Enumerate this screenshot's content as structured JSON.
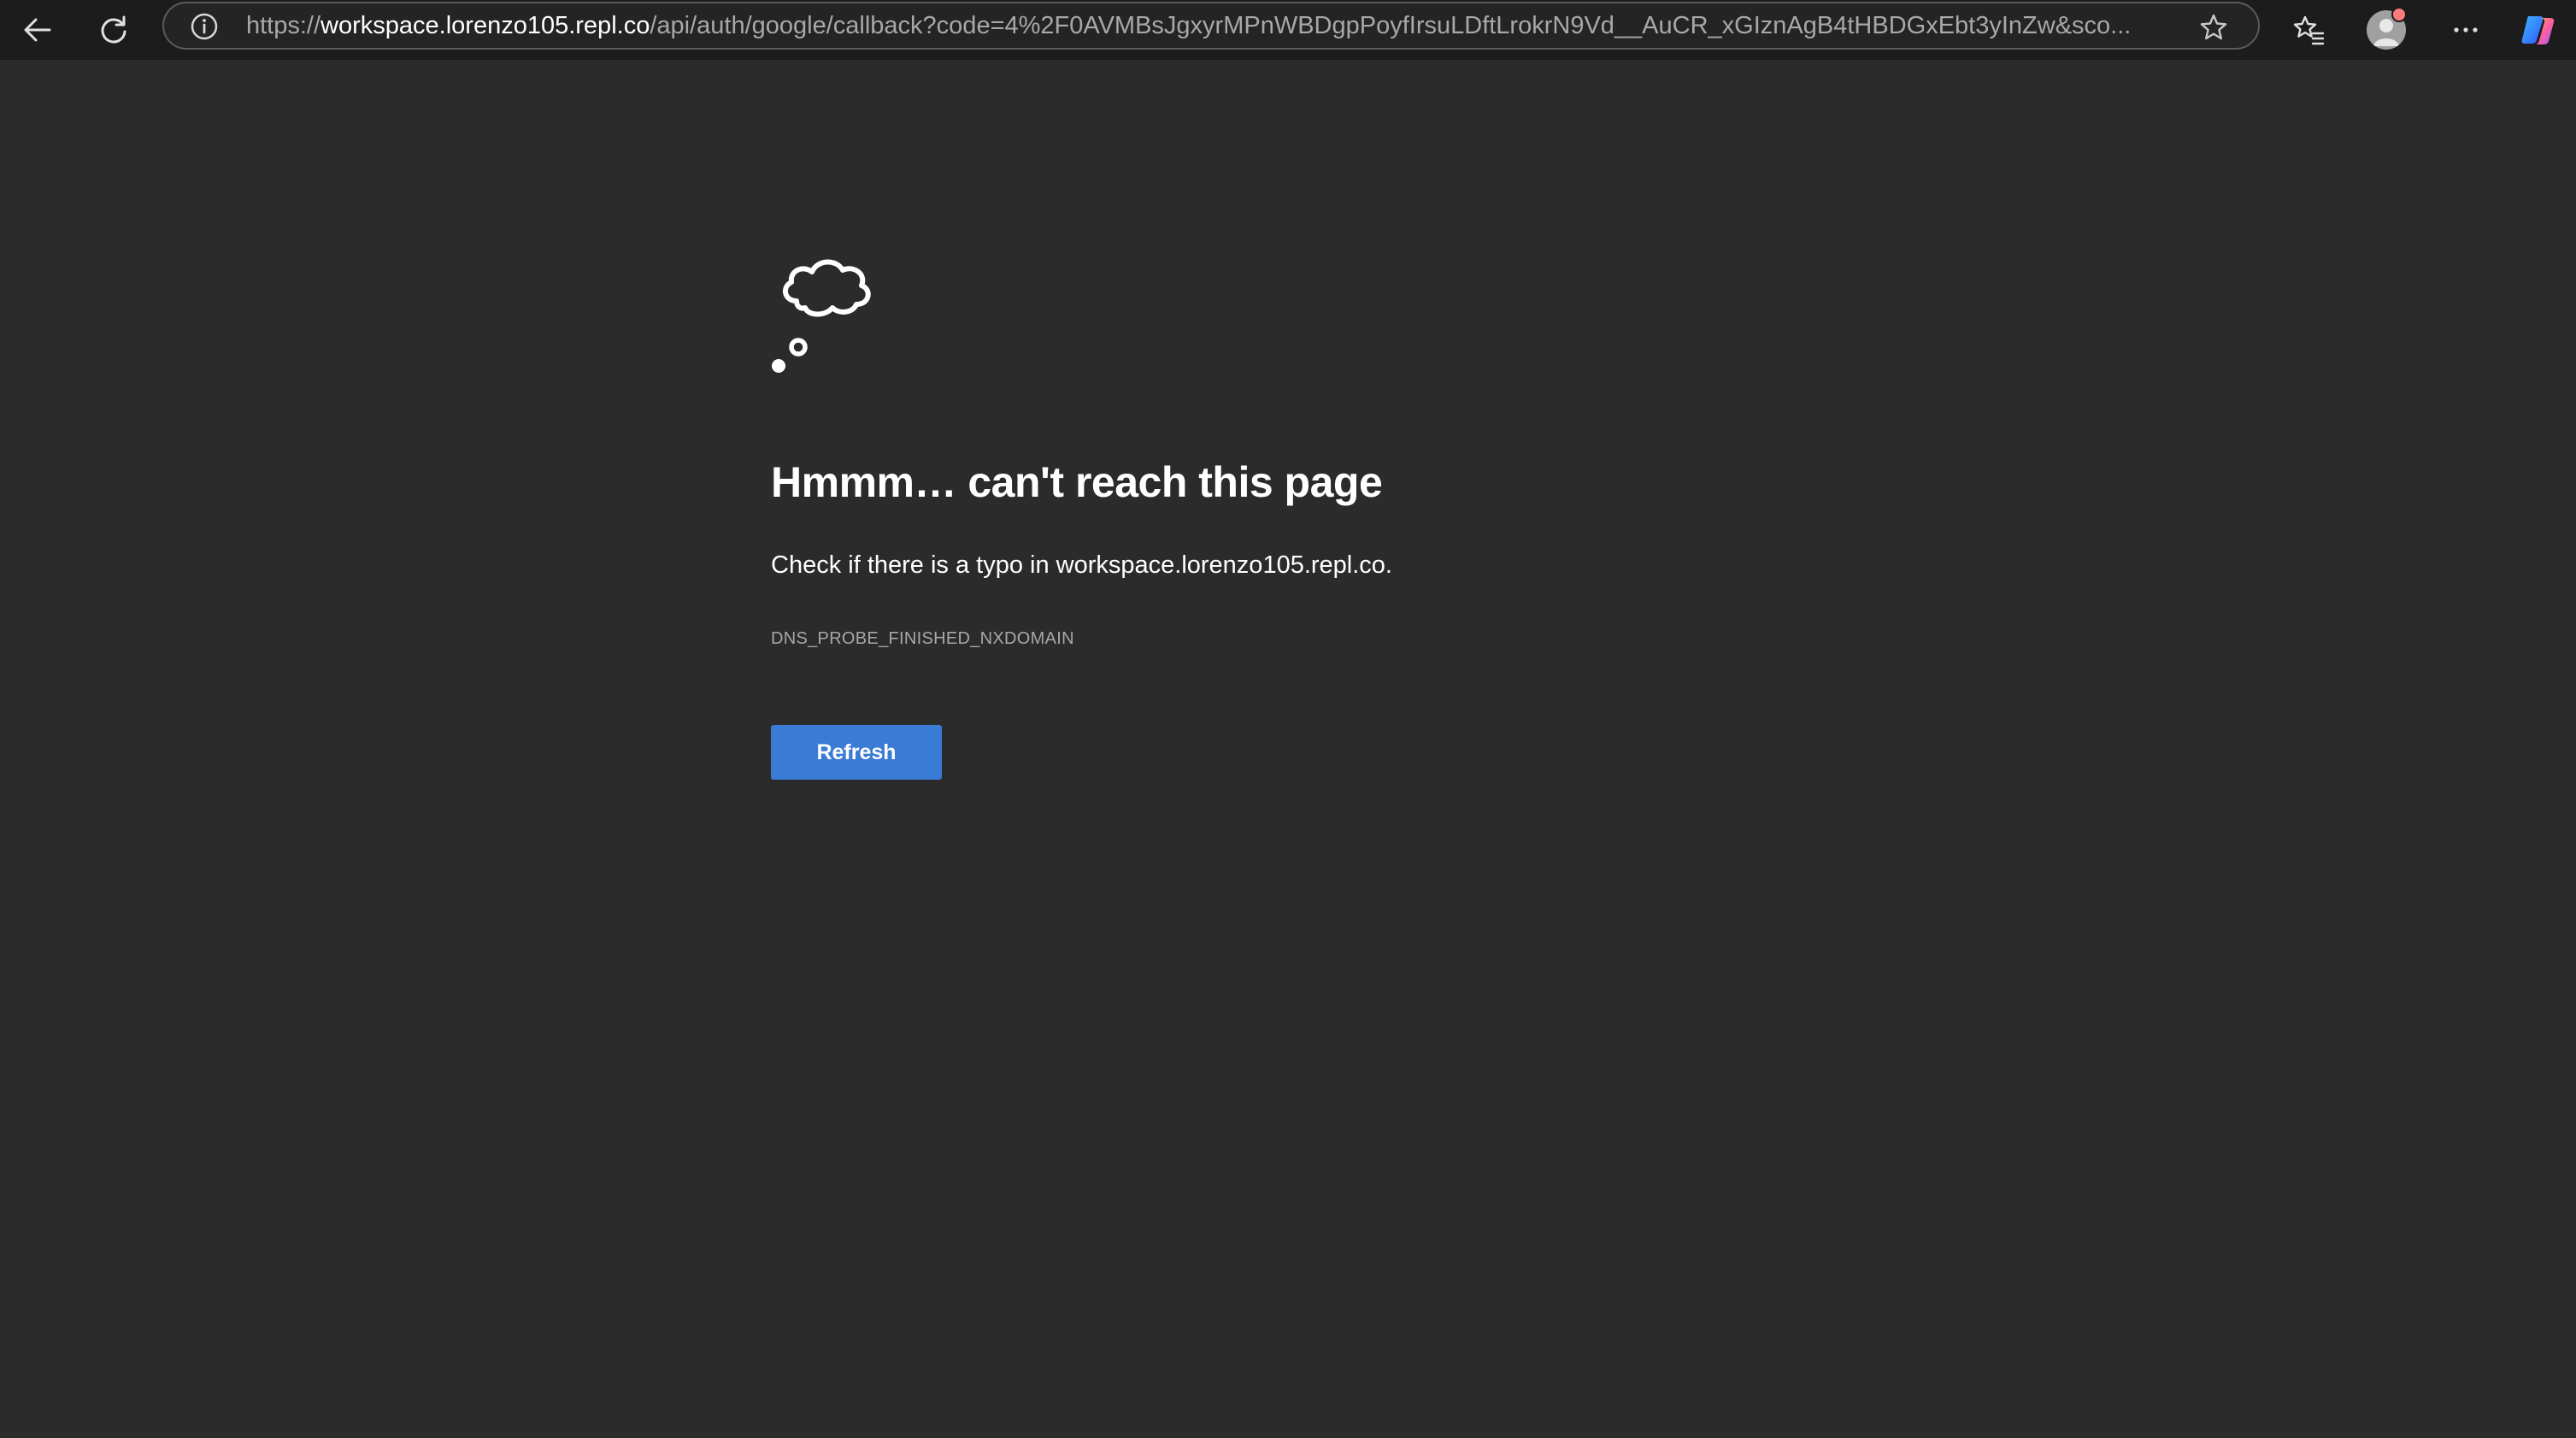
{
  "browser": {
    "address_bar": {
      "url_scheme": "https://",
      "url_host": "workspace.lorenzo105.repl.co",
      "url_rest": "/api/auth/google/callback?code=4%2F0AVMBsJgxyrMPnWBDgpPoyfIrsuLDftLrokrN9Vd__AuCR_xGIznAgB4tHBDGxEbt3yInZw&sco..."
    },
    "icons": {
      "back": "back-arrow-icon",
      "reload": "reload-icon",
      "site_info": "info-icon",
      "add_favorite": "star-icon",
      "favorites": "favorites-star-list-icon",
      "profile": "profile-avatar-icon",
      "menu": "more-dots-icon",
      "copilot": "copilot-icon"
    }
  },
  "error_page": {
    "icon": "thought-cloud-icon",
    "title": "Hmmm… can't reach this page",
    "message": "Check if there is a typo in workspace.lorenzo105.repl.co.",
    "error_code": "DNS_PROBE_FINISHED_NXDOMAIN",
    "refresh_label": "Refresh"
  },
  "colors": {
    "page_background": "#2b2b2b",
    "toolbar_background": "#1c1c1c",
    "button_accent": "#3a7bd5",
    "notification_dot": "#ff7a7a"
  }
}
